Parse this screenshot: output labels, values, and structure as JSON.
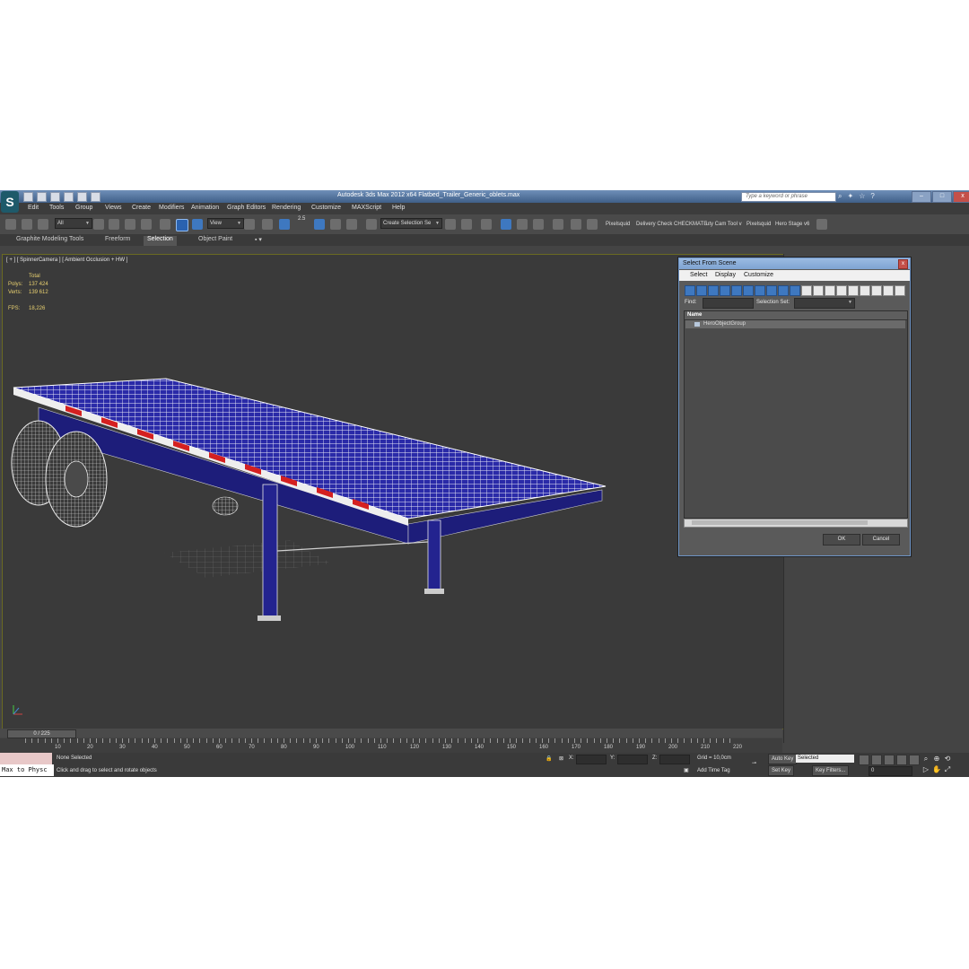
{
  "titlebar": {
    "app_title": "Autodesk 3ds Max  2012 x64     Flatbed_Trailer_Generic_oblets.max",
    "search_placeholder": "Type a keyword or phrase",
    "minimize": "–",
    "maximize": "□",
    "close": "x",
    "logo_glyph": "S"
  },
  "menu": [
    "Edit",
    "Tools",
    "Group",
    "Views",
    "Create",
    "Modifiers",
    "Animation",
    "Graph Editors",
    "Rendering",
    "Customize",
    "MAXScript",
    "Help"
  ],
  "toolbar": {
    "filter_dropdown": "All",
    "ref_coord_dropdown": "View",
    "snap_label": "2.5",
    "named_selection_dropdown": "Create Selection Se",
    "plugins": [
      "Pixelsquid",
      "Delivery Check",
      "CHECKMATE",
      "uty Cam Tool v",
      "Pixelsquid",
      "Hero Stage v6"
    ]
  },
  "ribbon": {
    "tabs": [
      "Graphite Modeling Tools",
      "Freeform",
      "Selection",
      "Object Paint"
    ],
    "active_tab": "Selection"
  },
  "viewport": {
    "label": "[ + ] [ SpinnerCamera ] [ Ambient Occlusion + HW ]",
    "stats": {
      "total_label": "Total",
      "polys_label": "Polys:",
      "polys_value": "137 424",
      "verts_label": "Verts:",
      "verts_value": "139 612",
      "fps_label": "FPS:",
      "fps_value": "18,226"
    }
  },
  "dialog": {
    "title": "Select From Scene",
    "close": "x",
    "menu": [
      "Select",
      "Display",
      "Customize"
    ],
    "find_label": "Find:",
    "selection_set_label": "Selection Set:",
    "list_header": "Name",
    "items": [
      "HeroObjectGroup"
    ],
    "ok": "OK",
    "cancel": "Cancel"
  },
  "timeline": {
    "frame_indicator": "0 / 225",
    "ruler_labels": [
      "10",
      "20",
      "30",
      "40",
      "50",
      "60",
      "70",
      "80",
      "90",
      "100",
      "110",
      "120",
      "130",
      "140",
      "150",
      "160",
      "170",
      "180",
      "190",
      "200",
      "210",
      "220"
    ]
  },
  "status": {
    "maxscript_text": "Max to Physc",
    "selection_status": "None Selected",
    "prompt": "Click and drag to select and rotate objects",
    "x_label": "X:",
    "y_label": "Y:",
    "z_label": "Z:",
    "grid": "Grid = 10,0cm",
    "add_time_tag": "Add Time Tag",
    "auto_key": "Auto Key",
    "set_key": "Set Key",
    "selected_dropdown": "Selected",
    "key_filters": "Key Filters...",
    "frame_field": "0"
  },
  "colors": {
    "trailer_frame": "#23238f",
    "deck_wire": "#f2f2f2",
    "stripe_red": "#d42020",
    "viewport_bg": "#3a3a3a"
  }
}
